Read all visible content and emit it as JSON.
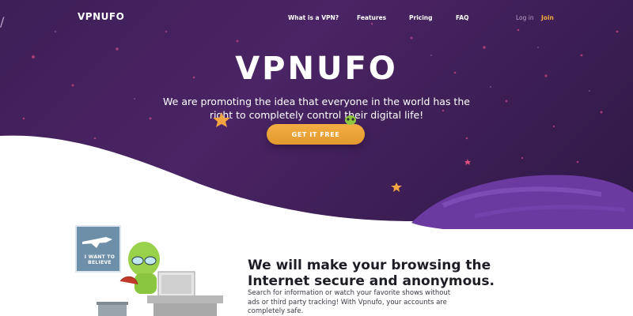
{
  "brand": {
    "name": "VPNUFO",
    "accent": "#f0a93b",
    "hero_bg": "#3e1f57"
  },
  "nav": {
    "items": [
      "What is a VPN?",
      "Features",
      "Pricing",
      "FAQ"
    ],
    "login": "Log in",
    "separator": "/",
    "join": "Join"
  },
  "hero": {
    "title": "VPNUFO",
    "subtitle": "We are promoting the idea that everyone in the world has the right to completely control their digital life!",
    "cta": "GET IT FREE"
  },
  "feature": {
    "title": "We will make your browsing the Internet secure and anonymous.",
    "body": "Search for information or watch your favorite shows without ads or third party tracking! With Vpnufo, your accounts are completely safe.",
    "poster_text": "I WANT TO BELIEVE"
  },
  "icons": [
    "star-icon",
    "alien-icon",
    "planet-icon",
    "space-shuttle-icon",
    "computer-icon"
  ]
}
